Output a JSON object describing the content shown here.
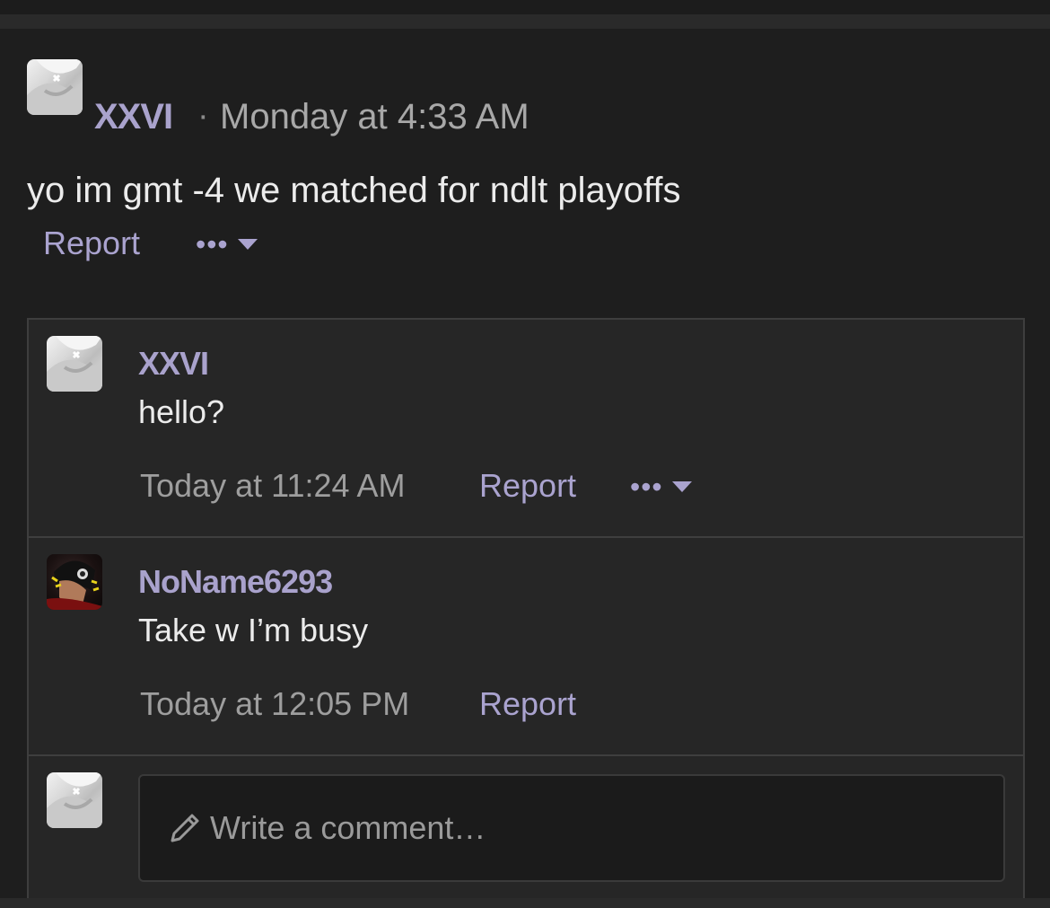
{
  "post": {
    "author": "XXVI",
    "separator": "·",
    "time": "Monday at 4:33 AM",
    "text": "yo im gmt -4 we matched for ndlt playoffs",
    "report_label": "Report",
    "more_label": "•••"
  },
  "comments": [
    {
      "author": "XXVI",
      "text": "hello?",
      "time": "Today at 11:24 AM",
      "report_label": "Report",
      "more_label": "•••"
    },
    {
      "author": "NoName6293",
      "text": "Take w I’m busy",
      "time": "Today at 12:05 PM",
      "report_label": "Report"
    }
  ],
  "composer": {
    "placeholder": "Write a comment…"
  },
  "icons": {
    "more": "ellipsis-icon",
    "dropdown": "caret-down-icon",
    "compose": "pencil-icon"
  },
  "colors": {
    "accent": "#aaa3cf",
    "background": "#1e1e1e",
    "thread_background": "#262626"
  }
}
